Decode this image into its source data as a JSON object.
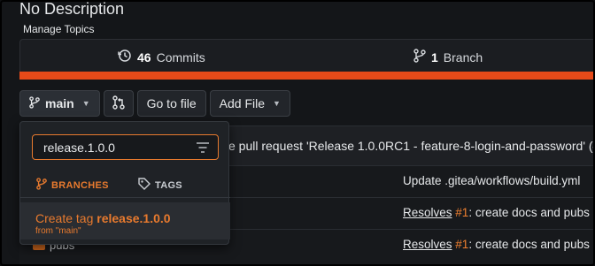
{
  "repo": {
    "description": "No Description",
    "manage_topics": "Manage Topics"
  },
  "stats": {
    "commits_count": "46",
    "commits_label": "Commits",
    "branches_count": "1",
    "branches_label": "Branch"
  },
  "colors": {
    "accent": "#e87a2e",
    "language_bar": "#e64a19"
  },
  "toolbar": {
    "branch": "main",
    "go_to_file": "Go to file",
    "add_file": "Add File"
  },
  "latest_commit": {
    "message": "e pull request 'Release 1.0.0RC1 - feature-8-login-and-password' (",
    "hash": "#"
  },
  "files": [
    {
      "name": "",
      "message_prefix": "",
      "issue": "",
      "message": "Update .gitea/workflows/build.yml"
    },
    {
      "name": "",
      "message_prefix": "Resolves",
      "issue": "#1",
      "message": ": create docs and pubs"
    },
    {
      "name": "pubs",
      "message_prefix": "Resolves",
      "issue": "#1",
      "message": ": create docs and pubs"
    }
  ],
  "dropdown": {
    "search_value": "release.1.0.0",
    "tab_branches": "BRANCHES",
    "tab_tags": "TAGS",
    "create_tag_prefix": "Create tag",
    "create_tag_name": "release.1.0.0",
    "create_from": "from \"main\""
  }
}
